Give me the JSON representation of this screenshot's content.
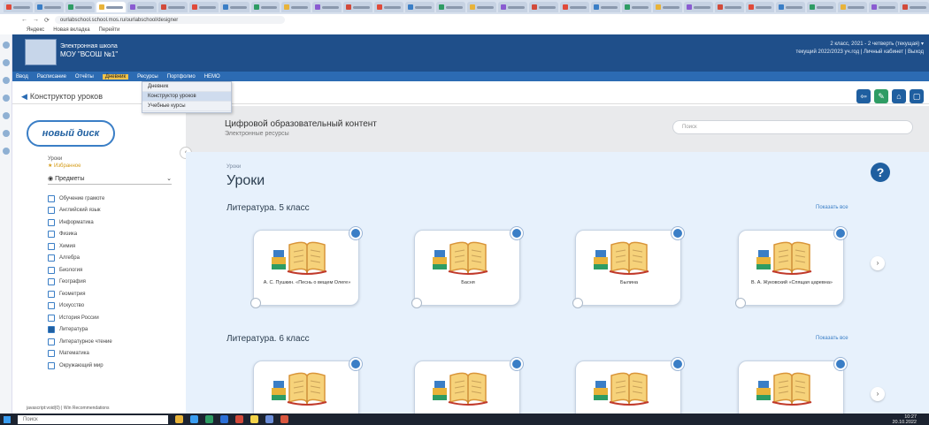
{
  "browser": {
    "tabs_count": 30,
    "url": "ourlabschool.school.mos.ru/ourlabschool/designer",
    "bookmarks": [
      "Яндекс",
      "Новая вкладка",
      "Перейти"
    ]
  },
  "header": {
    "org_line1": "Электронная школа",
    "org_line2": "МОУ \"ВСОШ №1\"",
    "right_line1": "2 класс, 2021 - 2 четверть (текущая) ▾",
    "right_line2": "текущий 2022/2023 уч.год | Личный кабинет | Выход"
  },
  "menu": {
    "items": [
      "Ввод",
      "Расписание",
      "Отчёты",
      "Дневник",
      "Ресурсы",
      "Портфолио",
      "НЕМО"
    ],
    "active_index": 3
  },
  "submenu": {
    "items": [
      "Дневник",
      "Конструктор уроков",
      "Учебные курсы"
    ],
    "highlight_index": 1
  },
  "designer": {
    "title": "Конструктор уроков"
  },
  "content_header": {
    "brand": "новый диск",
    "title": "Цифровой образовательный контент",
    "subtitle": "Электронные ресурсы",
    "search_placeholder": "Поиск"
  },
  "left_panel": {
    "top_label": "Уроки",
    "favorites_label": "Избранное",
    "subject_select": "Предметы",
    "subjects": [
      {
        "label": "Обучение грамоте",
        "checked": false
      },
      {
        "label": "Английский язык",
        "checked": false
      },
      {
        "label": "Информатика",
        "checked": false
      },
      {
        "label": "Физика",
        "checked": false
      },
      {
        "label": "Химия",
        "checked": false
      },
      {
        "label": "Алгебра",
        "checked": false
      },
      {
        "label": "Биология",
        "checked": false
      },
      {
        "label": "География",
        "checked": false
      },
      {
        "label": "Геометрия",
        "checked": false
      },
      {
        "label": "Искусство",
        "checked": false
      },
      {
        "label": "История России",
        "checked": false
      },
      {
        "label": "Литература",
        "checked": true
      },
      {
        "label": "Литературное чтение",
        "checked": false
      },
      {
        "label": "Математика",
        "checked": false
      },
      {
        "label": "Окружающий мир",
        "checked": false
      }
    ]
  },
  "main": {
    "breadcrumb": "Уроки",
    "page_title": "Уроки",
    "sections": [
      {
        "title": "Литература. 5 класс",
        "show_all": "Показать все",
        "cards": [
          "А. С. Пушкин. «Песнь о вещем Олеге»",
          "Басня",
          "Былина",
          "В. А. Жуковский «Спящая царевна»"
        ]
      },
      {
        "title": "Литература. 6 класс",
        "show_all": "Показать все",
        "cards": [
          "",
          "",
          "",
          ""
        ]
      }
    ]
  },
  "hint": "javascript:void(0) | Win Recommendations",
  "taskbar": {
    "search_placeholder": "Поиск",
    "clock_time": "10:27",
    "clock_date": "20.10.2022"
  }
}
